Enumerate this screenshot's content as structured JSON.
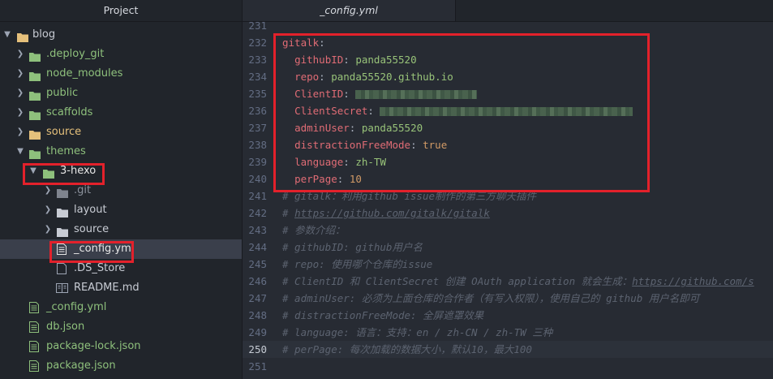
{
  "sidebar": {
    "title": "Project",
    "tree": [
      {
        "label": "blog",
        "kind": "folder",
        "expanded": true,
        "color": "green"
      },
      {
        "label": ".deploy_git",
        "kind": "folder",
        "expanded": false,
        "color": "green"
      },
      {
        "label": "node_modules",
        "kind": "folder",
        "expanded": false,
        "color": "green"
      },
      {
        "label": "public",
        "kind": "folder",
        "expanded": false,
        "color": "green"
      },
      {
        "label": "scaffolds",
        "kind": "folder",
        "expanded": false,
        "color": "green"
      },
      {
        "label": "source",
        "kind": "folder",
        "expanded": false,
        "color": "orange"
      },
      {
        "label": "themes",
        "kind": "folder",
        "expanded": true,
        "color": "green"
      },
      {
        "label": "3-hexo",
        "kind": "folder",
        "expanded": true,
        "color": "green"
      },
      {
        "label": ".git",
        "kind": "folder",
        "expanded": false,
        "color": "grey"
      },
      {
        "label": "layout",
        "kind": "folder",
        "expanded": false,
        "color": "grey"
      },
      {
        "label": "source",
        "kind": "folder",
        "expanded": false,
        "color": "grey"
      },
      {
        "label": "_config.yml",
        "kind": "file",
        "selected": true
      },
      {
        "label": ".DS_Store",
        "kind": "file"
      },
      {
        "label": "README.md",
        "kind": "file"
      },
      {
        "label": "_config.yml",
        "kind": "file",
        "color": "green"
      },
      {
        "label": "db.json",
        "kind": "file",
        "color": "green"
      },
      {
        "label": "package-lock.json",
        "kind": "file",
        "color": "green"
      },
      {
        "label": "package.json",
        "kind": "file",
        "color": "green"
      }
    ]
  },
  "editor": {
    "tab_title": "_config.yml",
    "current_line": "250",
    "lines": [
      {
        "num": "231"
      },
      {
        "num": "232",
        "key": "gitalk"
      },
      {
        "num": "233",
        "key": "githubID",
        "value": "panda55520"
      },
      {
        "num": "234",
        "key": "repo",
        "value": "panda55520.github.io"
      },
      {
        "num": "235",
        "key": "ClientID"
      },
      {
        "num": "236",
        "key": "ClientSecret"
      },
      {
        "num": "237",
        "key": "adminUser",
        "value": "panda55520"
      },
      {
        "num": "238",
        "key": "distractionFreeMode",
        "value": "true"
      },
      {
        "num": "239",
        "key": "language",
        "value": "zh-TW"
      },
      {
        "num": "240",
        "key": "perPage",
        "value": "10"
      },
      {
        "num": "241",
        "comment": "# gitalk：利用github issue制作的第三方聊天插件"
      },
      {
        "num": "242",
        "comment_prefix": "# ",
        "link": "https://github.com/gitalk/gitalk"
      },
      {
        "num": "243",
        "comment": "# 参数介绍："
      },
      {
        "num": "244",
        "comment": "# githubID: github用户名"
      },
      {
        "num": "245",
        "comment": "# repo: 使用哪个仓库的issue"
      },
      {
        "num": "246",
        "comment_prefix": "# ClientID 和 ClientSecret 创建 OAuth application 就会生成：",
        "link": "https://github.com/s"
      },
      {
        "num": "247",
        "comment": "# adminUser: 必须为上面仓库的合作者（有写入权限），使用自己的 github 用户名即可"
      },
      {
        "num": "248",
        "comment": "# distractionFreeMode: 全屏遮罩效果"
      },
      {
        "num": "249",
        "comment": "# language: 语言：支持：en / zh-CN / zh-TW 三种"
      },
      {
        "num": "250",
        "comment": "# perPage: 每次加载的数据大小，默认10，最大100"
      },
      {
        "num": "251"
      }
    ]
  },
  "colors": {
    "highlight_box": "#e3212b",
    "folder_green": "#8ec07c",
    "folder_orange": "#e5c07b",
    "yaml_key": "#e06c75",
    "yaml_string": "#98c379",
    "yaml_number": "#d19a66",
    "comment": "#5c6370"
  }
}
